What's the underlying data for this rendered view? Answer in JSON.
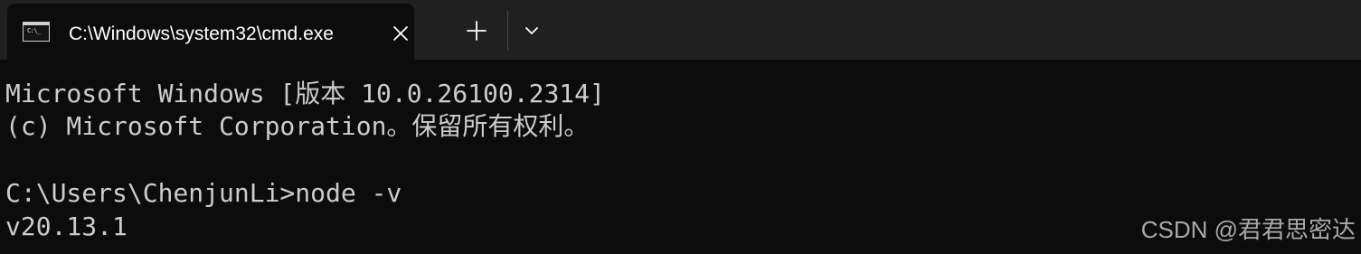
{
  "window": {
    "colors": {
      "tabbar_bg": "#202020",
      "active_tab_bg": "#0c0c0c",
      "console_bg": "#0c0c0c",
      "console_text": "#cccccc",
      "watermark_text": "#a9a9a9"
    }
  },
  "tabbar": {
    "active_tab": {
      "icon": "cmd-prompt-icon",
      "icon_text": "C:\\_",
      "title": "C:\\Windows\\system32\\cmd.exe",
      "close_icon": "close-icon"
    },
    "new_tab_icon": "plus-icon",
    "dropdown_icon": "chevron-down-icon"
  },
  "console": {
    "lines": [
      "Microsoft Windows [版本 10.0.26100.2314]",
      "(c) Microsoft Corporation。保留所有权利。",
      "",
      "C:\\Users\\ChenjunLi>node -v",
      "v20.13.1"
    ]
  },
  "watermark": {
    "text": "CSDN @君君思密达"
  }
}
